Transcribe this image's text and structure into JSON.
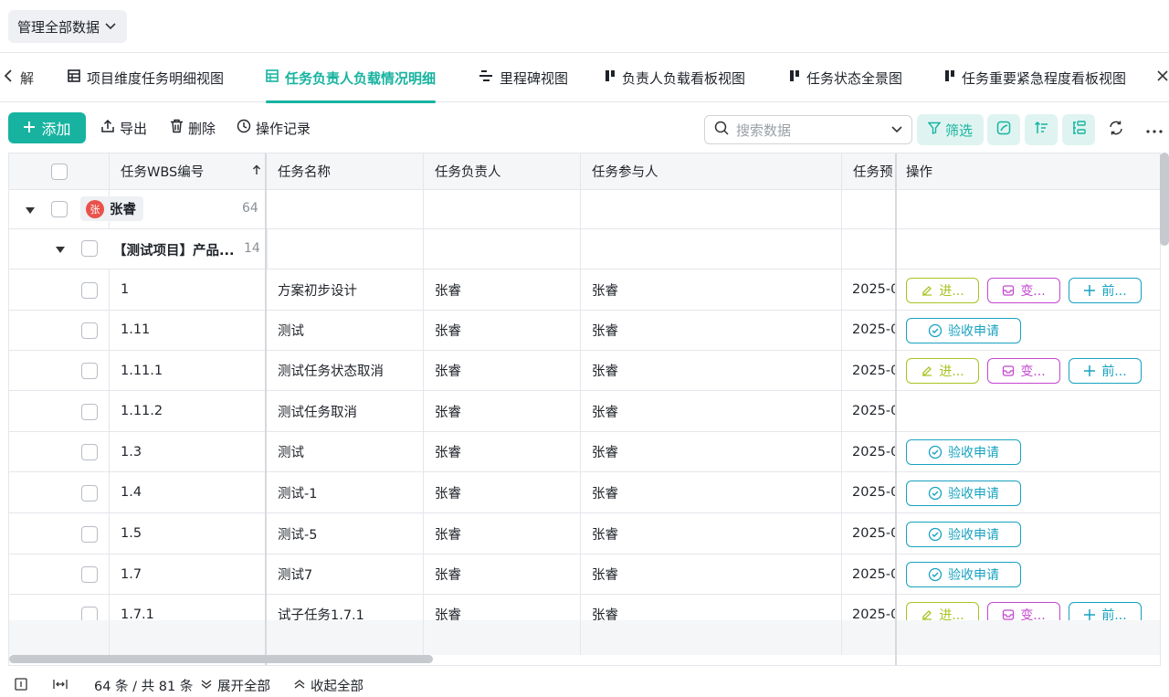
{
  "scope": {
    "label": "管理全部数据"
  },
  "tabs": {
    "prev_partial": "解",
    "items": [
      {
        "label": "项目维度任务明细视图",
        "icon": "table-icon"
      },
      {
        "label": "任务负责人负载情况明细",
        "icon": "table-icon",
        "active": true
      },
      {
        "label": "里程碑视图",
        "icon": "gantt-icon"
      },
      {
        "label": "负责人负载看板视图",
        "icon": "kanban-icon"
      },
      {
        "label": "任务状态全景图",
        "icon": "kanban-icon"
      },
      {
        "label": "任务重要紧急程度看板视图",
        "icon": "kanban-icon"
      }
    ]
  },
  "toolbar": {
    "add": "添加",
    "export": "导出",
    "delete": "删除",
    "log": "操作记录",
    "search_placeholder": "搜索数据",
    "filter": "筛选"
  },
  "columns": [
    "任务WBS编号",
    "任务名称",
    "任务负责人",
    "任务参与人",
    "任务预",
    "操作"
  ],
  "groups": {
    "owner": {
      "name": "张睿",
      "avatar": "张",
      "count": "64"
    },
    "project": {
      "name": "【测试项目】产品...",
      "count": "14"
    }
  },
  "actions": {
    "progress": "进...",
    "change": "变...",
    "pre": "前...",
    "accept": "验收申请"
  },
  "rows": [
    {
      "wbs": "1",
      "name": "方案初步设计",
      "owner": "张睿",
      "participant": "张睿",
      "date": "2025-0",
      "ops": "three"
    },
    {
      "wbs": "1.11",
      "name": "测试",
      "owner": "张睿",
      "participant": "张睿",
      "date": "2025-0",
      "ops": "accept"
    },
    {
      "wbs": "1.11.1",
      "name": "测试任务状态取消",
      "owner": "张睿",
      "participant": "张睿",
      "date": "2025-0",
      "ops": "three"
    },
    {
      "wbs": "1.11.2",
      "name": "测试任务取消",
      "owner": "张睿",
      "participant": "张睿",
      "date": "2025-0",
      "ops": "none"
    },
    {
      "wbs": "1.3",
      "name": "测试",
      "owner": "张睿",
      "participant": "张睿",
      "date": "2025-0",
      "ops": "accept"
    },
    {
      "wbs": "1.4",
      "name": "测试-1",
      "owner": "张睿",
      "participant": "张睿",
      "date": "2025-0",
      "ops": "accept"
    },
    {
      "wbs": "1.5",
      "name": "测试-5",
      "owner": "张睿",
      "participant": "张睿",
      "date": "2025-0",
      "ops": "accept"
    },
    {
      "wbs": "1.7",
      "name": "测试7",
      "owner": "张睿",
      "participant": "张睿",
      "date": "2025-0",
      "ops": "accept"
    },
    {
      "wbs": "1.7.1",
      "name": "试子任务1.7.1",
      "owner": "张睿",
      "participant": "张睿",
      "date": "2025-0",
      "ops": "three"
    }
  ],
  "status": {
    "count": "64 条 / 共 81 条",
    "expand_all": "展开全部",
    "collapse_all": "收起全部"
  }
}
